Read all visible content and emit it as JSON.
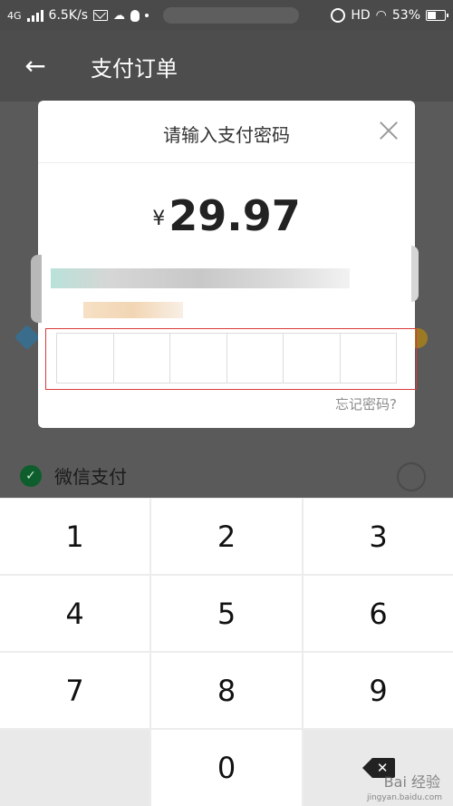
{
  "status_bar": {
    "network": "4G",
    "speed": "6.5K/s",
    "hd": "HD",
    "battery": "53%"
  },
  "header": {
    "back_icon": "arrow-left-icon",
    "title": "支付订单"
  },
  "dialog": {
    "title": "请输入支付密码",
    "close_icon": "close-icon",
    "currency_symbol": "¥",
    "amount": "29.97",
    "pin_length": 6,
    "forgot_link": "忘记密码?"
  },
  "behind": {
    "payment_option": "微信支付"
  },
  "keypad": {
    "keys": [
      "1",
      "2",
      "3",
      "4",
      "5",
      "6",
      "7",
      "8",
      "9",
      "0"
    ],
    "delete_icon": "backspace-icon"
  },
  "watermark": {
    "text": "Bai 经验",
    "sub": "jingyan.baidu.com"
  },
  "colors": {
    "highlight_border": "#d83a3a",
    "overlay": "#595959",
    "dialog_bg": "#ffffff"
  }
}
